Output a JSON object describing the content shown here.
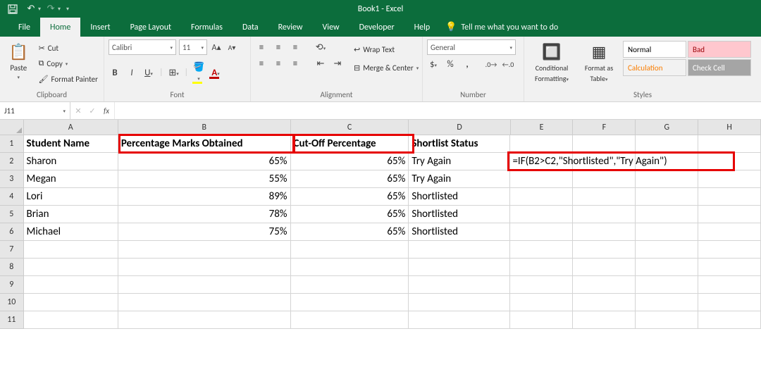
{
  "titlebar": {
    "title": "Book1 - Excel"
  },
  "menu": {
    "tabs": [
      "File",
      "Home",
      "Insert",
      "Page Layout",
      "Formulas",
      "Data",
      "Review",
      "View",
      "Developer",
      "Help"
    ],
    "active": 1,
    "tell": "Tell me what you want to do"
  },
  "ribbon": {
    "clipboard": {
      "paste": "Paste",
      "cut": "Cut",
      "copy": "Copy",
      "painter": "Format Painter",
      "label": "Clipboard"
    },
    "font": {
      "name": "Calibri",
      "size": "11",
      "label": "Font"
    },
    "alignment": {
      "wrap": "Wrap Text",
      "merge": "Merge & Center",
      "label": "Alignment"
    },
    "number": {
      "format": "General",
      "label": "Number"
    },
    "styles": {
      "cond": "Conditional",
      "cond2": "Formatting",
      "fas": "Format as",
      "fas2": "Table",
      "label": "Styles",
      "normal": "Normal",
      "bad": "Bad",
      "calc": "Calculation",
      "check": "Check Cell"
    }
  },
  "fxbar": {
    "namebox": "J11",
    "formula": ""
  },
  "columns": [
    "A",
    "B",
    "C",
    "D",
    "E",
    "F",
    "G",
    "H"
  ],
  "headers": {
    "A": "Student Name",
    "B": "Percentage Marks Obtained",
    "C": "Cut-Off Percentage",
    "D": "Shortlist Status"
  },
  "rows": [
    {
      "n": "1"
    },
    {
      "n": "2",
      "A": "Sharon",
      "B": "65%",
      "C": "65%",
      "D": "Try Again"
    },
    {
      "n": "3",
      "A": "Megan",
      "B": "55%",
      "C": "65%",
      "D": "Try Again"
    },
    {
      "n": "4",
      "A": "Lori",
      "B": "89%",
      "C": "65%",
      "D": "Shortlisted"
    },
    {
      "n": "5",
      "A": "Brian",
      "B": "78%",
      "C": "65%",
      "D": "Shortlisted"
    },
    {
      "n": "6",
      "A": "Michael",
      "B": "75%",
      "C": "65%",
      "D": "Shortlisted"
    },
    {
      "n": "7"
    },
    {
      "n": "8"
    },
    {
      "n": "9"
    },
    {
      "n": "10"
    },
    {
      "n": "11"
    }
  ],
  "annotation": {
    "formula": "=IF(B2>C2,\"Shortlisted\",\"Try Again\")"
  },
  "chart_data": {
    "type": "table",
    "columns": [
      "Student Name",
      "Percentage Marks Obtained",
      "Cut-Off Percentage",
      "Shortlist Status"
    ],
    "rows": [
      [
        "Sharon",
        "65%",
        "65%",
        "Try Again"
      ],
      [
        "Megan",
        "55%",
        "65%",
        "Try Again"
      ],
      [
        "Lori",
        "89%",
        "65%",
        "Shortlisted"
      ],
      [
        "Brian",
        "78%",
        "65%",
        "Shortlisted"
      ],
      [
        "Michael",
        "75%",
        "65%",
        "Shortlisted"
      ]
    ],
    "formula": "=IF(B2>C2,\"Shortlisted\",\"Try Again\")"
  }
}
